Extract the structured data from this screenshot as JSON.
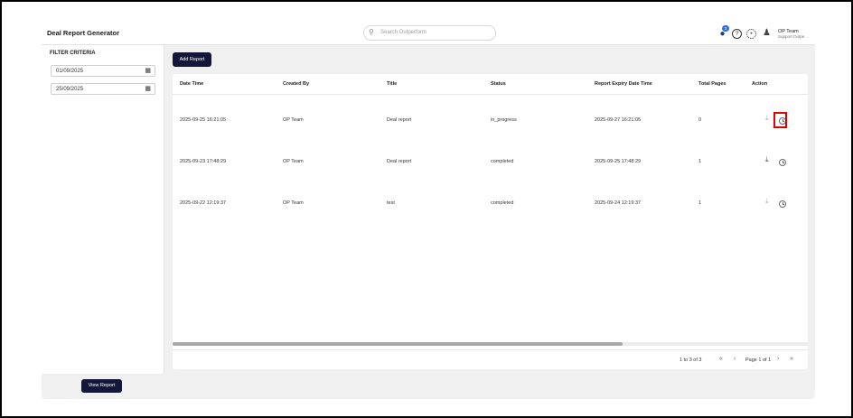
{
  "app": {
    "title": "Deal Report Generator"
  },
  "search": {
    "placeholder": "Search Outperform"
  },
  "header": {
    "notification_count": "3",
    "help_glyph": "?",
    "user_name": "OP Team",
    "user_role": "Support Outpe..."
  },
  "sidebar": {
    "filter_title": "FILTER CRITERIA",
    "start_date": "01/09/2025",
    "end_date": "25/09/2025",
    "view_button": "View Report"
  },
  "toolbar": {
    "add_button": "Add Report"
  },
  "table": {
    "columns": [
      "Date Time",
      "Created By",
      "Title",
      "Status",
      "Report Expiry Date Time",
      "Total Pages",
      "Action"
    ],
    "rows": [
      {
        "date_time": "2025-09-25 16:21:05",
        "created_by": "OP Team",
        "title": "Deal report",
        "status": "in_progress",
        "expiry": "2025-09-27 16:21:05",
        "pages": "0"
      },
      {
        "date_time": "2025-09-23 17:48:29",
        "created_by": "OP Team",
        "title": "Deal report",
        "status": "completed",
        "expiry": "2025-09-25 17:48:29",
        "pages": "1"
      },
      {
        "date_time": "2025-09-22 12:19:37",
        "created_by": "OP Team",
        "title": "test",
        "status": "completed",
        "expiry": "2025-09-24 12:19:37",
        "pages": "1"
      }
    ]
  },
  "pagination": {
    "range_text": "1 to 3 of 3",
    "page_text": "Page 1 of 1"
  },
  "icons": {
    "search": "search-icon",
    "notification": "bell-icon",
    "help": "help-icon",
    "settings": "gear-icon",
    "calendar": "calendar-icon",
    "download": "download-icon",
    "history": "clock-icon"
  },
  "colors": {
    "primary_button": "#14163a",
    "highlight": "#e00000",
    "badge": "#2f6fe0"
  }
}
